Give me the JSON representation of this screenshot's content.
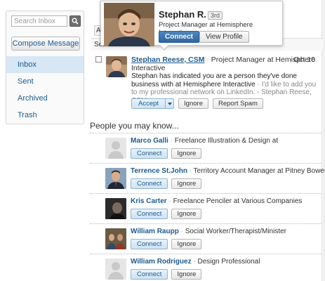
{
  "sidebar": {
    "search_placeholder": "Search Inbox",
    "compose_label": "Compose Message",
    "items": [
      {
        "label": "Inbox",
        "active": true
      },
      {
        "label": "Sent",
        "active": false
      },
      {
        "label": "Archived",
        "active": false
      },
      {
        "label": "Trash",
        "active": false
      }
    ]
  },
  "toolbar": {
    "partial_button": "Ad",
    "select_partial": "Sel"
  },
  "message": {
    "sender": "Stephan Reese, CSM",
    "sender_headline": "Project Manager at Hemisphere Interactive",
    "date": "Oct 10",
    "body_main": "Stephan has indicated you are a person they've done business with at Hemisphere Interactive",
    "body_snippet": "I'd like to add you to my professional network on LinkedIn. - Stephan Reese, CSM",
    "accept_label": "Accept",
    "ignore_label": "Ignore",
    "report_label": "Report Spam"
  },
  "hovercard": {
    "name": "Stephan R.",
    "degree": "3rd",
    "title": "Project Manager at Hemisphere Interactive",
    "connect_label": "Connect",
    "view_label": "View Profile"
  },
  "pymk": {
    "title": "People you may know...",
    "connect_label": "Connect",
    "ignore_label": "Ignore",
    "people": [
      {
        "name": "Marco Galli",
        "headline": "Freelance Illustration & Design at",
        "photo": "placeholder"
      },
      {
        "name": "Terrence St.John",
        "headline": "Territory Account Manager at Pitney Bowes",
        "photo": "man-suit"
      },
      {
        "name": "Kris Carter",
        "headline": "Freelance Penciler at Various Companies",
        "photo": "dark-portrait"
      },
      {
        "name": "William Raupp",
        "headline": "Social Worker/Therapist/Minister",
        "photo": "group"
      },
      {
        "name": "William Rodriguez",
        "headline": "Design Professional",
        "photo": "placeholder"
      }
    ]
  },
  "colors": {
    "link": "#1e5a8e",
    "active_nav": "#d7e7f5",
    "connect_primary": "#2f65a0"
  }
}
